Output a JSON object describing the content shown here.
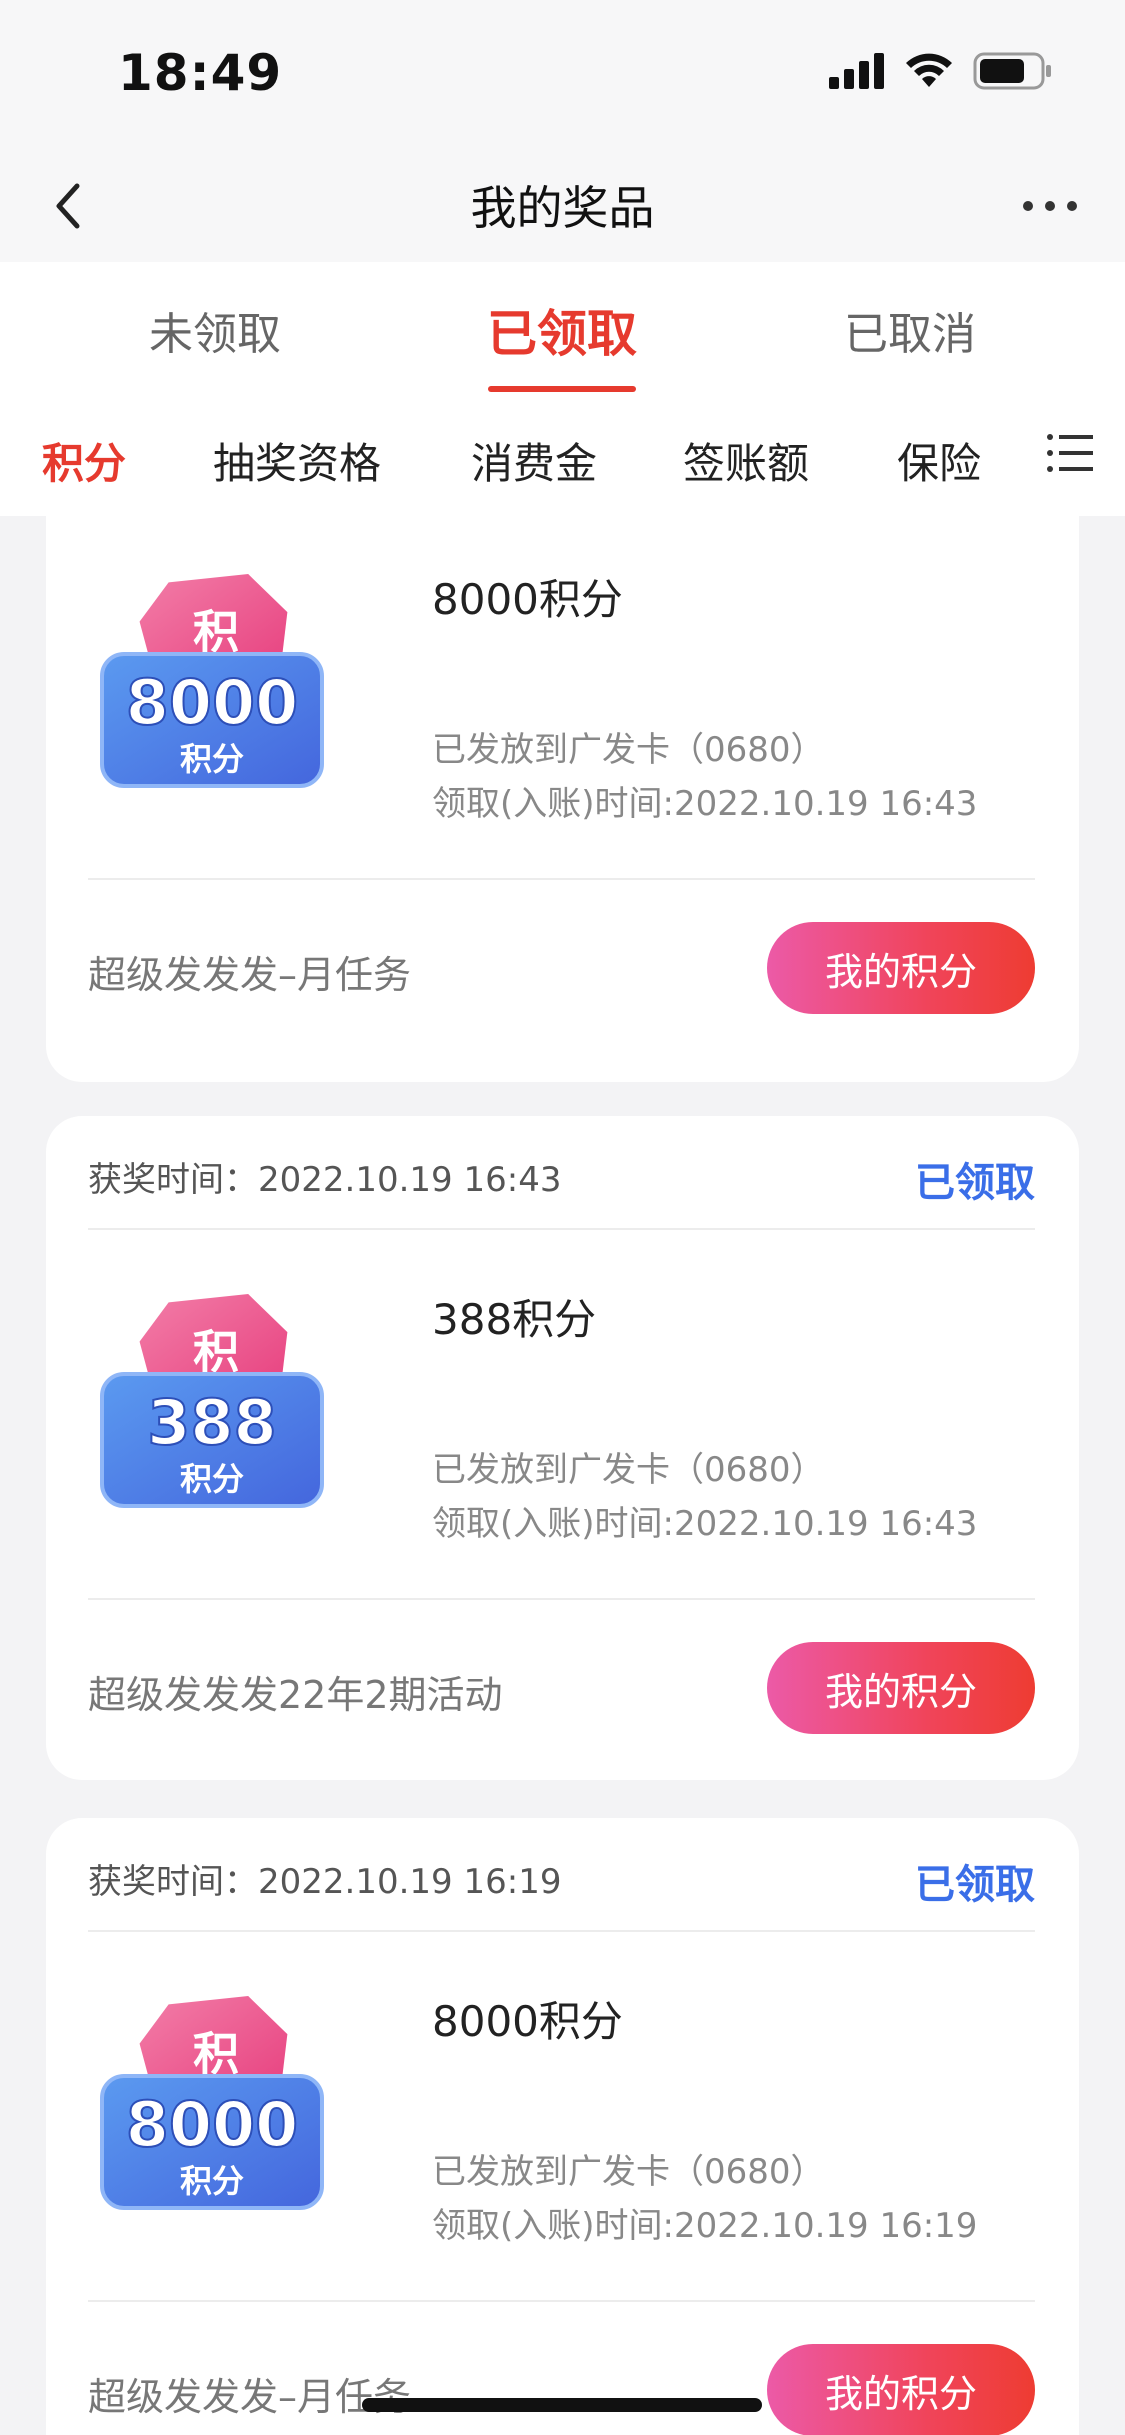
{
  "status_bar": {
    "time": "18:49"
  },
  "nav": {
    "title": "我的奖品"
  },
  "status_tabs": [
    {
      "label": "未领取",
      "active": false
    },
    {
      "label": "已领取",
      "active": true
    },
    {
      "label": "已取消",
      "active": false
    }
  ],
  "category_tabs": [
    {
      "label": "积分",
      "active": true
    },
    {
      "label": "抽奖资格",
      "active": false
    },
    {
      "label": "消费金",
      "active": false
    },
    {
      "label": "签账额",
      "active": false
    },
    {
      "label": "保险",
      "active": false
    }
  ],
  "badge_labels": {
    "top_char": "积",
    "unit": "积分"
  },
  "cards": [
    {
      "award_time": "",
      "status": "",
      "badge_number": "8000",
      "title": "8000积分",
      "sent_to": "已发放到广发卡（0680）",
      "claim_time": "领取(入账)时间:2022.10.19 16:43",
      "activity": "超级发发发–月任务",
      "button": "我的积分"
    },
    {
      "award_time": "获奖时间：2022.10.19 16:43",
      "status": "已领取",
      "badge_number": "388",
      "title": "388积分",
      "sent_to": "已发放到广发卡（0680）",
      "claim_time": "领取(入账)时间:2022.10.19 16:43",
      "activity": "超级发发发22年2期活动",
      "button": "我的积分"
    },
    {
      "award_time": "获奖时间：2022.10.19 16:19",
      "status": "已领取",
      "badge_number": "8000",
      "title": "8000积分",
      "sent_to": "已发放到广发卡（0680）",
      "claim_time": "领取(入账)时间:2022.10.19 16:19",
      "activity": "超级发发发–月任务",
      "button": "我的积分"
    }
  ],
  "colors": {
    "accent_red": "#e63a2e",
    "status_blue": "#3a6ee8"
  }
}
